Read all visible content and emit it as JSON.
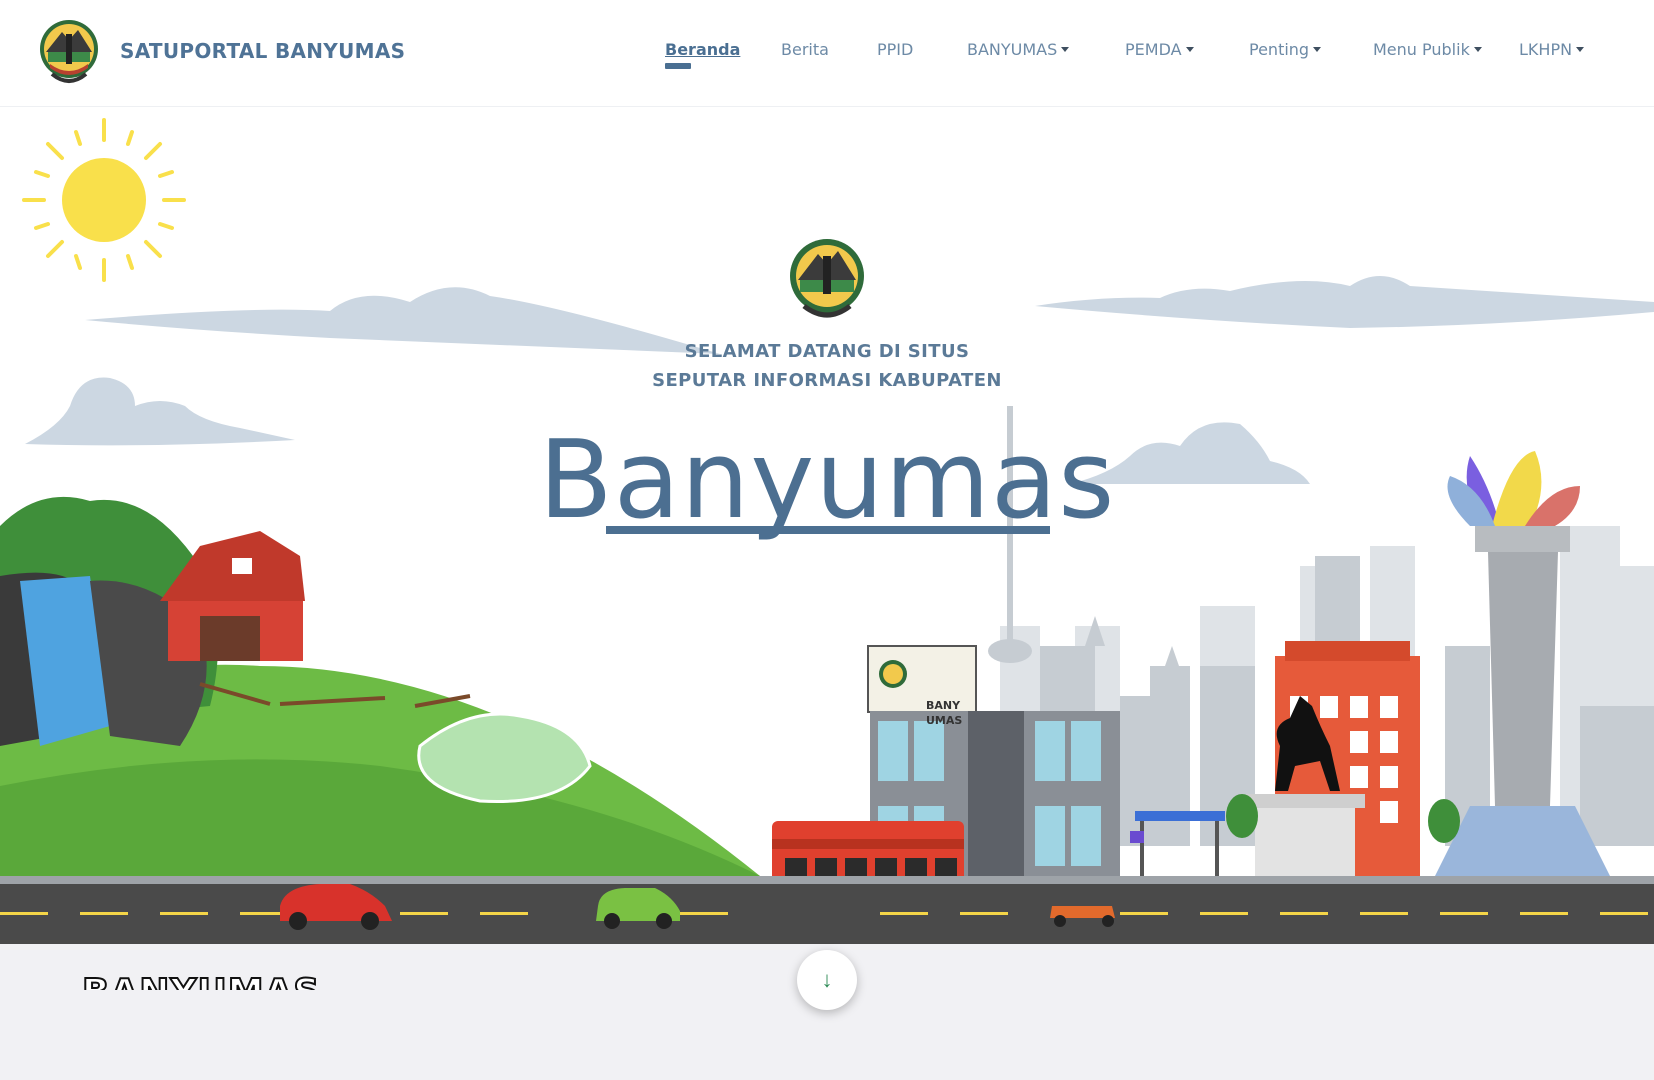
{
  "site": {
    "brand_name": "SATUPORTAL BANYUMAS",
    "logo_icon": "banyumas-seal-icon"
  },
  "nav": {
    "items": [
      {
        "label": "Beranda",
        "active": true,
        "dropdown": false
      },
      {
        "label": "Berita",
        "active": false,
        "dropdown": false
      },
      {
        "label": "PPID",
        "active": false,
        "dropdown": false
      },
      {
        "label": "BANYUMAS",
        "active": false,
        "dropdown": true
      },
      {
        "label": "PEMDA",
        "active": false,
        "dropdown": true
      },
      {
        "label": "Penting",
        "active": false,
        "dropdown": true
      },
      {
        "label": "Menu Publik",
        "active": false,
        "dropdown": true
      },
      {
        "label": "LKHPN",
        "active": false,
        "dropdown": true
      }
    ]
  },
  "hero": {
    "greeting_line1": "SELAMAT DATANG DI SITUS",
    "greeting_line2": "SEPUTAR INFORMASI KABUPATEN",
    "title": "Banyumas",
    "ground_label": "BANYUMAS",
    "billboard_line1": "BANY",
    "billboard_line2": "UMAS",
    "scroll_icon": "arrow-down-icon"
  },
  "colors": {
    "brand": "#4f7396",
    "nav_text": "#6d8aa6",
    "title": "#4c6f91",
    "sun": "#f9e04b",
    "cloud": "#ccd7e2",
    "grass": "#6dbb45",
    "road": "#4a4a4a"
  }
}
